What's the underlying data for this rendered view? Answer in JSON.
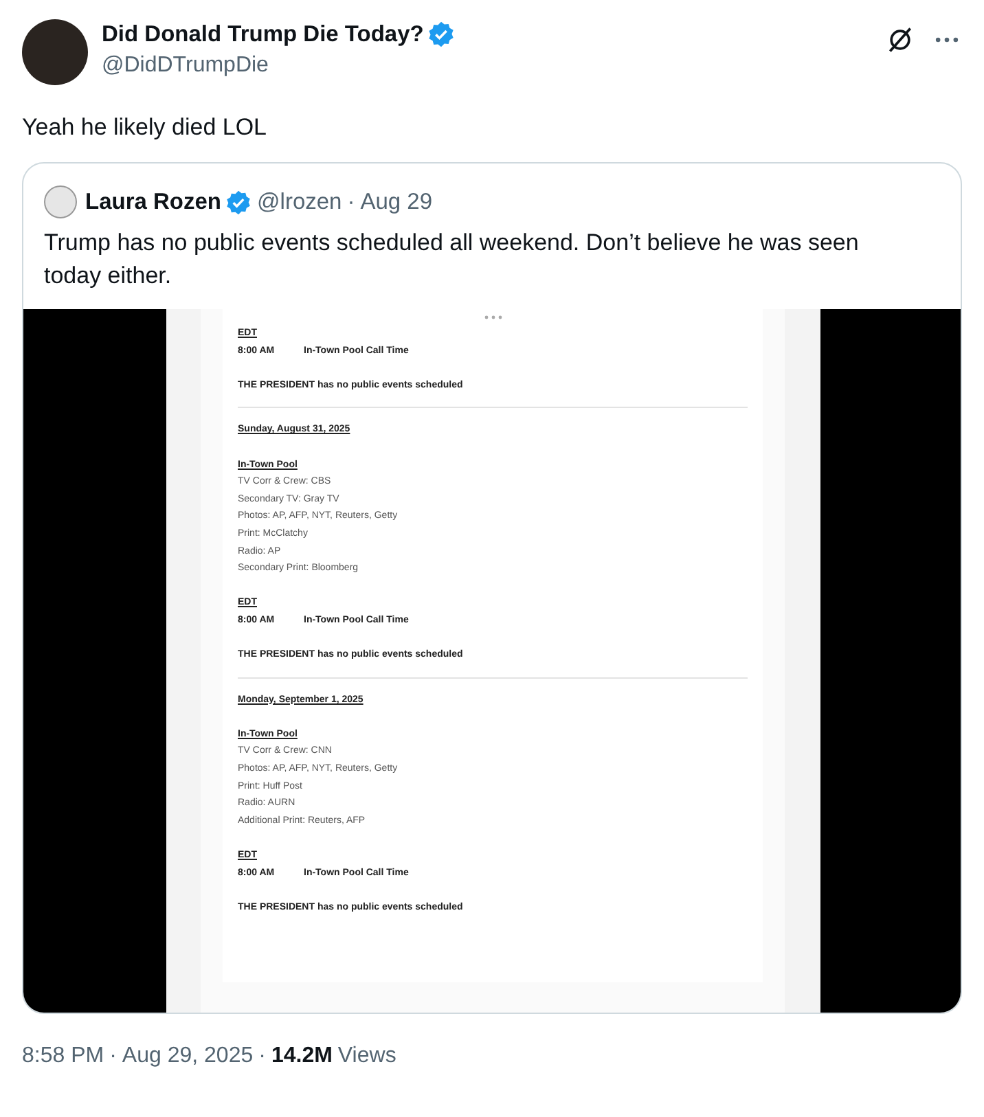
{
  "tweet": {
    "author": {
      "name": "Did Donald Trump Die Today?",
      "handle": "@DidDTrumpDie",
      "verified": true
    },
    "text": "Yeah he likely died LOL",
    "quote": {
      "author": {
        "name": "Laura Rozen",
        "handle": "@lrozen",
        "verified": true
      },
      "separator": "·",
      "date": "Aug 29",
      "text": "Trump has no public events scheduled all weekend. Don’t believe he was seen today either.",
      "media": {
        "kind": "screenshot",
        "sections": [
          {
            "time_zone": "EDT",
            "time": "8:00 AM",
            "event": "In-Town Pool Call Time",
            "note": "THE PRESIDENT has no public events scheduled"
          },
          {
            "date": "Sunday, August 31, 2025",
            "pool": "In-Town Pool",
            "pool_lines": [
              "TV Corr & Crew: CBS",
              "Secondary TV: Gray TV",
              "Photos: AP, AFP, NYT, Reuters, Getty",
              "Print: McClatchy",
              "Radio: AP",
              "Secondary Print: Bloomberg"
            ],
            "time_zone": "EDT",
            "time": "8:00 AM",
            "event": "In-Town Pool Call Time",
            "note": "THE PRESIDENT has no public events scheduled"
          },
          {
            "date": "Monday, September 1, 2025",
            "pool": "In-Town Pool",
            "pool_lines": [
              "TV Corr & Crew: CNN",
              "Photos: AP, AFP, NYT, Reuters, Getty",
              "Print: Huff Post",
              "Radio: AURN",
              "Additional Print: Reuters, AFP"
            ],
            "time_zone": "EDT",
            "time": "8:00 AM",
            "event": "In-Town Pool Call Time",
            "note": "THE PRESIDENT has no public events scheduled"
          }
        ]
      }
    },
    "time": "8:58 PM",
    "separator_1": "·",
    "date": "Aug 29, 2025",
    "separator_2": "·",
    "views_count": "14.2M",
    "views_label": "Views"
  }
}
